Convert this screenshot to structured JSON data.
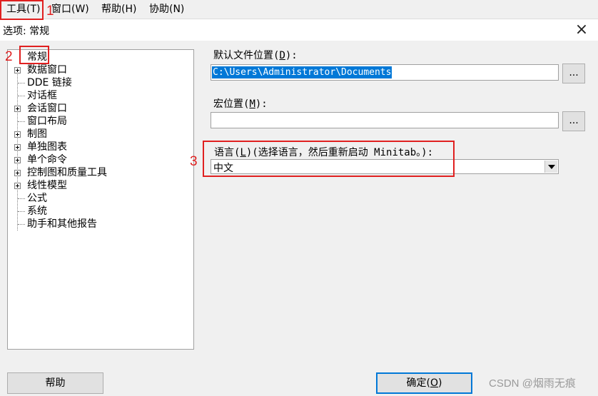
{
  "menubar": {
    "items": [
      {
        "label": "工具(T)"
      },
      {
        "label": "窗口(W)"
      },
      {
        "label": "帮助(H)"
      },
      {
        "label": "协助(N)"
      }
    ]
  },
  "dialog": {
    "title": "选项: 常规"
  },
  "tree": {
    "items": [
      {
        "label": "常规"
      },
      {
        "label": "数据窗口"
      },
      {
        "label": "DDE 链接"
      },
      {
        "label": "对话框"
      },
      {
        "label": "会话窗口"
      },
      {
        "label": "窗口布局"
      },
      {
        "label": "制图"
      },
      {
        "label": "单独图表"
      },
      {
        "label": "单个命令"
      },
      {
        "label": "控制图和质量工具"
      },
      {
        "label": "线性模型"
      },
      {
        "label": "公式"
      },
      {
        "label": "系统"
      },
      {
        "label": "助手和其他报告"
      }
    ]
  },
  "form": {
    "default_location_label_pre": "默认文件位置(",
    "default_location_key": "D",
    "default_location_label_post": "):",
    "default_location_value": "C:\\Users\\Administrator\\Documents",
    "macro_location_label_pre": "宏位置(",
    "macro_location_key": "M",
    "macro_location_label_post": "):",
    "macro_location_value": "",
    "browse_label": "...",
    "language_label_pre": "语言(",
    "language_key": "L",
    "language_label_post": ")(选择语言，然后重新启动 Minitab。):",
    "language_value": "中文"
  },
  "buttons": {
    "help": "帮助",
    "ok_pre": "确定(",
    "ok_key": "O",
    "ok_post": ")"
  },
  "annotations": {
    "step1": "1",
    "step2": "2",
    "step3": "3",
    "color": "#e02020"
  },
  "watermark": "CSDN @烟雨无痕"
}
